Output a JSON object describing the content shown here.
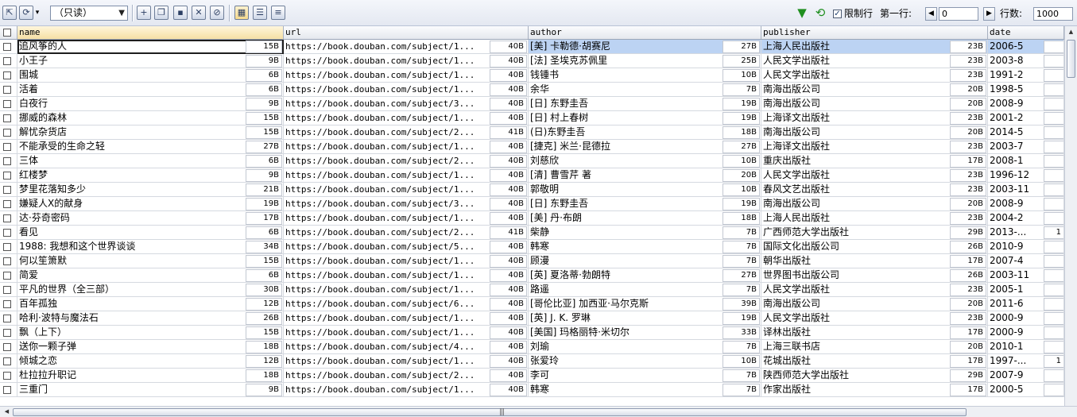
{
  "toolbar": {
    "access_mode": "（只读）",
    "filter_limit_label": "限制行",
    "filter_limit_checked": true,
    "first_row_label": "第一行:",
    "first_row_value": "0",
    "rows_label": "行数:",
    "rows_value": "1000",
    "icons": [
      "export-icon",
      "refresh-icon",
      "dropdown-icon",
      "add-row-icon",
      "duplicate-row-icon",
      "save-icon",
      "delete-icon",
      "discard-icon",
      "grid-view-icon",
      "form-view-icon",
      "text-view-icon",
      "filter-icon",
      "reload-icon"
    ]
  },
  "columns": [
    "name",
    "url",
    "author",
    "publisher",
    "date"
  ],
  "rows": [
    {
      "name": "追风筝的人",
      "name_size": "15B",
      "url": "https://book.douban.com/subject/1...",
      "url_size": "40B",
      "author": "[美] 卡勒德·胡赛尼",
      "author_size": "27B",
      "publisher": "上海人民出版社",
      "publisher_size": "23B",
      "date": "2006-5"
    },
    {
      "name": "小王子",
      "name_size": "9B",
      "url": "https://book.douban.com/subject/1...",
      "url_size": "40B",
      "author": "[法] 圣埃克苏佩里",
      "author_size": "25B",
      "publisher": "人民文学出版社",
      "publisher_size": "23B",
      "date": "2003-8"
    },
    {
      "name": "围城",
      "name_size": "6B",
      "url": "https://book.douban.com/subject/1...",
      "url_size": "40B",
      "author": "钱锺书",
      "author_size": "10B",
      "publisher": "人民文学出版社",
      "publisher_size": "23B",
      "date": "1991-2"
    },
    {
      "name": "活着",
      "name_size": "6B",
      "url": "https://book.douban.com/subject/1...",
      "url_size": "40B",
      "author": "余华",
      "author_size": "7B",
      "publisher": "南海出版公司",
      "publisher_size": "20B",
      "date": "1998-5"
    },
    {
      "name": "白夜行",
      "name_size": "9B",
      "url": "https://book.douban.com/subject/3...",
      "url_size": "40B",
      "author": "[日] 东野圭吾",
      "author_size": "19B",
      "publisher": "南海出版公司",
      "publisher_size": "20B",
      "date": "2008-9"
    },
    {
      "name": "挪威的森林",
      "name_size": "15B",
      "url": "https://book.douban.com/subject/1...",
      "url_size": "40B",
      "author": "[日] 村上春树",
      "author_size": "19B",
      "publisher": "上海译文出版社",
      "publisher_size": "23B",
      "date": "2001-2"
    },
    {
      "name": "解忧杂货店",
      "name_size": "15B",
      "url": "https://book.douban.com/subject/2...",
      "url_size": "41B",
      "author": "(日)东野圭吾",
      "author_size": "18B",
      "publisher": "南海出版公司",
      "publisher_size": "20B",
      "date": "2014-5"
    },
    {
      "name": "不能承受的生命之轻",
      "name_size": "27B",
      "url": "https://book.douban.com/subject/1...",
      "url_size": "40B",
      "author": "[捷克] 米兰·昆德拉",
      "author_size": "27B",
      "publisher": "上海译文出版社",
      "publisher_size": "23B",
      "date": "2003-7"
    },
    {
      "name": "三体",
      "name_size": "6B",
      "url": "https://book.douban.com/subject/2...",
      "url_size": "40B",
      "author": "刘慈欣",
      "author_size": "10B",
      "publisher": "重庆出版社",
      "publisher_size": "17B",
      "date": "2008-1"
    },
    {
      "name": "红楼梦",
      "name_size": "9B",
      "url": "https://book.douban.com/subject/1...",
      "url_size": "40B",
      "author": "[清] 曹雪芹 著",
      "author_size": "20B",
      "publisher": "人民文学出版社",
      "publisher_size": "23B",
      "date": "1996-12"
    },
    {
      "name": "梦里花落知多少",
      "name_size": "21B",
      "url": "https://book.douban.com/subject/1...",
      "url_size": "40B",
      "author": "郭敬明",
      "author_size": "10B",
      "publisher": "春风文艺出版社",
      "publisher_size": "23B",
      "date": "2003-11"
    },
    {
      "name": "嫌疑人X的献身",
      "name_size": "19B",
      "url": "https://book.douban.com/subject/3...",
      "url_size": "40B",
      "author": "[日] 东野圭吾",
      "author_size": "19B",
      "publisher": "南海出版公司",
      "publisher_size": "20B",
      "date": "2008-9"
    },
    {
      "name": "达·芬奇密码",
      "name_size": "17B",
      "url": "https://book.douban.com/subject/1...",
      "url_size": "40B",
      "author": "[美] 丹·布朗",
      "author_size": "18B",
      "publisher": "上海人民出版社",
      "publisher_size": "23B",
      "date": "2004-2"
    },
    {
      "name": "看见",
      "name_size": "6B",
      "url": "https://book.douban.com/subject/2...",
      "url_size": "41B",
      "author": "柴静",
      "author_size": "7B",
      "publisher": "广西师范大学出版社",
      "publisher_size": "29B",
      "date": "2013-...",
      "extra": "1"
    },
    {
      "name": "1988: 我想和这个世界谈谈",
      "name_size": "34B",
      "url": "https://book.douban.com/subject/5...",
      "url_size": "40B",
      "author": "韩寒",
      "author_size": "7B",
      "publisher": "国际文化出版公司",
      "publisher_size": "26B",
      "date": "2010-9"
    },
    {
      "name": "何以笙箫默",
      "name_size": "15B",
      "url": "https://book.douban.com/subject/1...",
      "url_size": "40B",
      "author": "顾漫",
      "author_size": "7B",
      "publisher": "朝华出版社",
      "publisher_size": "17B",
      "date": "2007-4"
    },
    {
      "name": "简爱",
      "name_size": "6B",
      "url": "https://book.douban.com/subject/1...",
      "url_size": "40B",
      "author": "[英] 夏洛蒂·勃朗特",
      "author_size": "27B",
      "publisher": "世界图书出版公司",
      "publisher_size": "26B",
      "date": "2003-11"
    },
    {
      "name": "平凡的世界（全三部）",
      "name_size": "30B",
      "url": "https://book.douban.com/subject/1...",
      "url_size": "40B",
      "author": "路遥",
      "author_size": "7B",
      "publisher": "人民文学出版社",
      "publisher_size": "23B",
      "date": "2005-1"
    },
    {
      "name": "百年孤独",
      "name_size": "12B",
      "url": "https://book.douban.com/subject/6...",
      "url_size": "40B",
      "author": "[哥伦比亚] 加西亚·马尔克斯",
      "author_size": "39B",
      "publisher": "南海出版公司",
      "publisher_size": "20B",
      "date": "2011-6"
    },
    {
      "name": "哈利·波特与魔法石",
      "name_size": "26B",
      "url": "https://book.douban.com/subject/1...",
      "url_size": "40B",
      "author": "[英] J. K. 罗琳",
      "author_size": "19B",
      "publisher": "人民文学出版社",
      "publisher_size": "23B",
      "date": "2000-9"
    },
    {
      "name": "飘（上下）",
      "name_size": "15B",
      "url": "https://book.douban.com/subject/1...",
      "url_size": "40B",
      "author": "[美国] 玛格丽特·米切尔",
      "author_size": "33B",
      "publisher": "译林出版社",
      "publisher_size": "17B",
      "date": "2000-9"
    },
    {
      "name": "送你一颗子弹",
      "name_size": "18B",
      "url": "https://book.douban.com/subject/4...",
      "url_size": "40B",
      "author": "刘瑜",
      "author_size": "7B",
      "publisher": "上海三联书店",
      "publisher_size": "20B",
      "date": "2010-1"
    },
    {
      "name": "倾城之恋",
      "name_size": "12B",
      "url": "https://book.douban.com/subject/1...",
      "url_size": "40B",
      "author": "张爱玲",
      "author_size": "10B",
      "publisher": "花城出版社",
      "publisher_size": "17B",
      "date": "1997-...",
      "extra": "1"
    },
    {
      "name": "杜拉拉升职记",
      "name_size": "18B",
      "url": "https://book.douban.com/subject/2...",
      "url_size": "40B",
      "author": "李可",
      "author_size": "7B",
      "publisher": "陕西师范大学出版社",
      "publisher_size": "29B",
      "date": "2007-9"
    },
    {
      "name": "三重门",
      "name_size": "9B",
      "url": "https://book.douban.com/subject/1...",
      "url_size": "40B",
      "author": "韩寒",
      "author_size": "7B",
      "publisher": "作家出版社",
      "publisher_size": "17B",
      "date": "2000-5"
    }
  ],
  "scrollbar_grip": "|||"
}
